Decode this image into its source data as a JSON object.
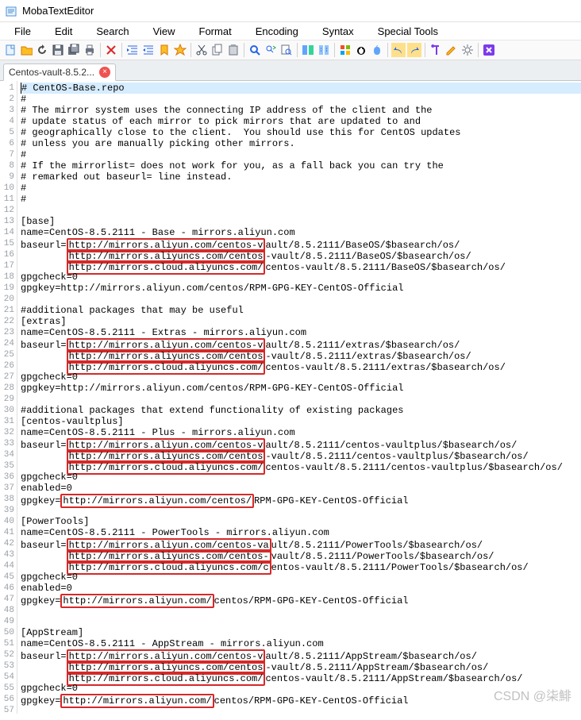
{
  "title": "MobaTextEditor",
  "menus": [
    "File",
    "Edit",
    "Search",
    "View",
    "Format",
    "Encoding",
    "Syntax",
    "Special Tools"
  ],
  "tab": {
    "label": "Centos-vault-8.5.2...",
    "close": "×"
  },
  "lines": [
    {
      "n": 1,
      "frag": [
        {
          "t": "# CentOS-Base.repo"
        }
      ],
      "current": true
    },
    {
      "n": 2,
      "frag": [
        {
          "t": "#"
        }
      ]
    },
    {
      "n": 3,
      "frag": [
        {
          "t": "# The mirror system uses the connecting IP address of the client and the"
        }
      ]
    },
    {
      "n": 4,
      "frag": [
        {
          "t": "# update status of each mirror to pick mirrors that are updated to and"
        }
      ]
    },
    {
      "n": 5,
      "frag": [
        {
          "t": "# geographically close to the client.  You should use this for CentOS updates"
        }
      ]
    },
    {
      "n": 6,
      "frag": [
        {
          "t": "# unless you are manually picking other mirrors."
        }
      ]
    },
    {
      "n": 7,
      "frag": [
        {
          "t": "#"
        }
      ]
    },
    {
      "n": 8,
      "frag": [
        {
          "t": "# If the mirrorlist= does not work for you, as a fall back you can try the"
        }
      ]
    },
    {
      "n": 9,
      "frag": [
        {
          "t": "# remarked out baseurl= line instead."
        }
      ]
    },
    {
      "n": 10,
      "frag": [
        {
          "t": "#"
        }
      ]
    },
    {
      "n": 11,
      "frag": [
        {
          "t": "#"
        }
      ]
    },
    {
      "n": 12,
      "frag": [
        {
          "t": ""
        }
      ]
    },
    {
      "n": 13,
      "frag": [
        {
          "t": "[base]"
        }
      ]
    },
    {
      "n": 14,
      "frag": [
        {
          "t": "name=CentOS-8.5.2111 - Base - mirrors.aliyun.com"
        }
      ]
    },
    {
      "n": 15,
      "frag": [
        {
          "t": "baseurl="
        },
        {
          "t": "http://mirrors.aliyun.com/centos-v",
          "hl": 1
        },
        {
          "t": "ault/8.5.2111/BaseOS/$basearch/os/"
        }
      ]
    },
    {
      "n": 16,
      "frag": [
        {
          "t": "        "
        },
        {
          "t": "http://mirrors.aliyuncs.com/centos",
          "hl": 1
        },
        {
          "t": "-vault/8.5.2111/BaseOS/$basearch/os/"
        }
      ]
    },
    {
      "n": 17,
      "frag": [
        {
          "t": "        "
        },
        {
          "t": "http://mirrors.cloud.aliyuncs.com/",
          "hl": 1
        },
        {
          "t": "centos-vault/8.5.2111/BaseOS/$basearch/os/"
        }
      ]
    },
    {
      "n": 18,
      "frag": [
        {
          "t": "gpgcheck=0"
        }
      ]
    },
    {
      "n": 19,
      "frag": [
        {
          "t": "gpgkey=http://mirrors.aliyun.com/centos/RPM-GPG-KEY-CentOS-Official"
        }
      ]
    },
    {
      "n": 20,
      "frag": [
        {
          "t": ""
        }
      ]
    },
    {
      "n": 21,
      "frag": [
        {
          "t": "#additional packages that may be useful"
        }
      ]
    },
    {
      "n": 22,
      "frag": [
        {
          "t": "[extras]"
        }
      ]
    },
    {
      "n": 23,
      "frag": [
        {
          "t": "name=CentOS-8.5.2111 - Extras - mirrors.aliyun.com"
        }
      ]
    },
    {
      "n": 24,
      "frag": [
        {
          "t": "baseurl="
        },
        {
          "t": "http://mirrors.aliyun.com/centos-v",
          "hl": 1
        },
        {
          "t": "ault/8.5.2111/extras/$basearch/os/"
        }
      ]
    },
    {
      "n": 25,
      "frag": [
        {
          "t": "        "
        },
        {
          "t": "http://mirrors.aliyuncs.com/centos",
          "hl": 1
        },
        {
          "t": "-vault/8.5.2111/extras/$basearch/os/"
        }
      ]
    },
    {
      "n": 26,
      "frag": [
        {
          "t": "        "
        },
        {
          "t": "http://mirrors.cloud.aliyuncs.com/",
          "hl": 1
        },
        {
          "t": "centos-vault/8.5.2111/extras/$basearch/os/"
        }
      ]
    },
    {
      "n": 27,
      "frag": [
        {
          "t": "gpgcheck=0"
        }
      ]
    },
    {
      "n": 28,
      "frag": [
        {
          "t": "gpgkey=http://mirrors.aliyun.com/centos/RPM-GPG-KEY-CentOS-Official"
        }
      ]
    },
    {
      "n": 29,
      "frag": [
        {
          "t": ""
        }
      ]
    },
    {
      "n": 30,
      "frag": [
        {
          "t": "#additional packages that extend functionality of existing packages"
        }
      ]
    },
    {
      "n": 31,
      "frag": [
        {
          "t": "[centos-vaultplus]"
        }
      ]
    },
    {
      "n": 32,
      "frag": [
        {
          "t": "name=CentOS-8.5.2111 - Plus - mirrors.aliyun.com"
        }
      ]
    },
    {
      "n": 33,
      "frag": [
        {
          "t": "baseurl="
        },
        {
          "t": "http://mirrors.aliyun.com/centos-v",
          "hl": 1
        },
        {
          "t": "ault/8.5.2111/centos-vaultplus/$basearch/os/"
        }
      ]
    },
    {
      "n": 34,
      "frag": [
        {
          "t": "        "
        },
        {
          "t": "http://mirrors.aliyuncs.com/centos",
          "hl": 1
        },
        {
          "t": "-vault/8.5.2111/centos-vaultplus/$basearch/os/"
        }
      ]
    },
    {
      "n": 35,
      "frag": [
        {
          "t": "        "
        },
        {
          "t": "http://mirrors.cloud.aliyuncs.com/",
          "hl": 1
        },
        {
          "t": "centos-vault/8.5.2111/centos-vaultplus/$basearch/os/"
        }
      ]
    },
    {
      "n": 36,
      "frag": [
        {
          "t": "gpgcheck=0"
        }
      ]
    },
    {
      "n": 37,
      "frag": [
        {
          "t": "enabled=0"
        }
      ]
    },
    {
      "n": 38,
      "frag": [
        {
          "t": "gpgkey="
        },
        {
          "t": "http://mirrors.aliyun.com/centos/",
          "hl": 1
        },
        {
          "t": "RPM-GPG-KEY-CentOS-Official"
        }
      ]
    },
    {
      "n": 39,
      "frag": [
        {
          "t": ""
        }
      ]
    },
    {
      "n": 40,
      "frag": [
        {
          "t": "[PowerTools]"
        }
      ]
    },
    {
      "n": 41,
      "frag": [
        {
          "t": "name=CentOS-8.5.2111 - PowerTools - mirrors.aliyun.com"
        }
      ]
    },
    {
      "n": 42,
      "frag": [
        {
          "t": "baseurl="
        },
        {
          "t": "http://mirrors.aliyun.com/centos-va",
          "hl": 1
        },
        {
          "t": "ult/8.5.2111/PowerTools/$basearch/os/"
        }
      ]
    },
    {
      "n": 43,
      "frag": [
        {
          "t": "        "
        },
        {
          "t": "http://mirrors.aliyuncs.com/centos-",
          "hl": 1
        },
        {
          "t": "vault/8.5.2111/PowerTools/$basearch/os/"
        }
      ]
    },
    {
      "n": 44,
      "frag": [
        {
          "t": "        "
        },
        {
          "t": "http://mirrors.cloud.aliyuncs.com/c",
          "hl": 1
        },
        {
          "t": "entos-vault/8.5.2111/PowerTools/$basearch/os/"
        }
      ]
    },
    {
      "n": 45,
      "frag": [
        {
          "t": "gpgcheck=0"
        }
      ]
    },
    {
      "n": 46,
      "frag": [
        {
          "t": "enabled=0"
        }
      ]
    },
    {
      "n": 47,
      "frag": [
        {
          "t": "gpgkey="
        },
        {
          "t": "http://mirrors.aliyun.com/",
          "hl": 1
        },
        {
          "t": "centos/RPM-GPG-KEY-CentOS-Official"
        }
      ]
    },
    {
      "n": 48,
      "frag": [
        {
          "t": ""
        }
      ]
    },
    {
      "n": 49,
      "frag": [
        {
          "t": ""
        }
      ]
    },
    {
      "n": 50,
      "frag": [
        {
          "t": "[AppStream]"
        }
      ]
    },
    {
      "n": 51,
      "frag": [
        {
          "t": "name=CentOS-8.5.2111 - AppStream - mirrors.aliyun.com"
        }
      ]
    },
    {
      "n": 52,
      "frag": [
        {
          "t": "baseurl="
        },
        {
          "t": "http://mirrors.aliyun.com/centos-v",
          "hl": 1
        },
        {
          "t": "ault/8.5.2111/AppStream/$basearch/os/"
        }
      ]
    },
    {
      "n": 53,
      "frag": [
        {
          "t": "        "
        },
        {
          "t": "http://mirrors.aliyuncs.com/centos",
          "hl": 1
        },
        {
          "t": "-vault/8.5.2111/AppStream/$basearch/os/"
        }
      ]
    },
    {
      "n": 54,
      "frag": [
        {
          "t": "        "
        },
        {
          "t": "http://mirrors.cloud.aliyuncs.com/",
          "hl": 1
        },
        {
          "t": "centos-vault/8.5.2111/AppStream/$basearch/os/"
        }
      ]
    },
    {
      "n": 55,
      "frag": [
        {
          "t": "gpgcheck=0"
        }
      ]
    },
    {
      "n": 56,
      "frag": [
        {
          "t": "gpgkey="
        },
        {
          "t": "http://mirrors.aliyun.com/",
          "hl": 1
        },
        {
          "t": "centos/RPM-GPG-KEY-CentOS-Official"
        }
      ]
    },
    {
      "n": 57,
      "frag": [
        {
          "t": ""
        }
      ]
    }
  ],
  "watermark": "CSDN @柒鯡",
  "toolbar_icons": [
    {
      "name": "new-file-icon",
      "svg": "<rect x='3' y='2' width='10' height='12' fill='#eaf3fc' stroke='#4a90d9'/><path d='M9 2v4h4' fill='none' stroke='#4a90d9'/>"
    },
    {
      "name": "open-folder-icon",
      "svg": "<path d='M2 4h5l2 2h7v8H2z' fill='#fbbf24' stroke='#d97706'/>"
    },
    {
      "name": "refresh-icon",
      "svg": "<path d='M8 3a5 5 0 1 0 5 5h-2a3 3 0 1 1-3-3V3z' fill='#4a4a4a'/><path d='M8 1l3 3-3 3z' fill='#4a4a4a'/>"
    },
    {
      "name": "save-icon",
      "svg": "<rect x='2' y='2' width='12' height='12' fill='#6b7280' stroke='#374151'/><rect x='5' y='2' width='6' height='4' fill='#fff'/><rect x='4' y='9' width='8' height='5' fill='#e5e7eb'/>"
    },
    {
      "name": "save-all-icon",
      "svg": "<rect x='1' y='4' width='10' height='10' fill='#6b7280'/><rect x='4' y='1' width='10' height='10' fill='#9ca3af' stroke='#374151'/><rect x='6' y='1' width='5' height='3' fill='#fff'/>"
    },
    {
      "name": "print-icon",
      "svg": "<rect x='3' y='6' width='10' height='6' fill='#6b7280'/><rect x='5' y='2' width='6' height='4' fill='#fff' stroke='#6b7280'/><rect x='5' y='10' width='6' height='4' fill='#fff' stroke='#6b7280'/>"
    },
    {
      "sep": true
    },
    {
      "name": "close-icon",
      "svg": "<path d='M3 3l10 10M13 3L3 13' stroke='#dc2626' stroke-width='2'/>"
    },
    {
      "sep": true
    },
    {
      "name": "indent-left-icon",
      "svg": "<path d='M2 3h12M2 13h12M6 6h8M6 10h8' stroke='#2563eb'/><path d='M4 8L1 6v4z' fill='#2563eb'/>"
    },
    {
      "name": "indent-right-icon",
      "svg": "<path d='M2 3h12M2 13h12M6 6h8M6 10h8' stroke='#2563eb'/><path d='M1 8l3-2v4z' fill='#2563eb'/>"
    },
    {
      "name": "bookmark-icon",
      "svg": "<path d='M4 2h8v12l-4-3-4 3z' fill='#fbbf24' stroke='#d97706'/>"
    },
    {
      "name": "star-icon",
      "svg": "<path d='M8 1l2 5h5l-4 3 2 5-5-3-5 3 2-5-4-3h5z' fill='#fbbf24' stroke='#d97706'/>"
    },
    {
      "sep": true
    },
    {
      "name": "cut-icon",
      "svg": "<circle cx='4' cy='12' r='2' fill='none' stroke='#374151'/><circle cx='12' cy='12' r='2' fill='none' stroke='#374151'/><path d='M5 11L12 2M11 11L4 2' stroke='#374151'/>"
    },
    {
      "name": "copy-icon",
      "svg": "<rect x='2' y='4' width='8' height='10' fill='#fff' stroke='#6b7280'/><rect x='5' y='1' width='8' height='10' fill='#fff' stroke='#6b7280'/>"
    },
    {
      "name": "paste-icon",
      "svg": "<rect x='3' y='3' width='10' height='11' fill='#d1d5db' stroke='#6b7280'/><rect x='5' y='1' width='6' height='3' fill='#9ca3af'/>"
    },
    {
      "sep": true
    },
    {
      "name": "search-icon",
      "svg": "<circle cx='7' cy='7' r='4' fill='none' stroke='#2563eb' stroke-width='2'/><path d='M10 10l4 4' stroke='#2563eb' stroke-width='2'/>"
    },
    {
      "name": "replace-icon",
      "svg": "<circle cx='6' cy='6' r='3' fill='none' stroke='#2563eb'/><path d='M8 8l3 3' stroke='#2563eb'/><path d='M11 3l3 2-3 2' fill='none' stroke='#16a34a'/>"
    },
    {
      "name": "find-files-icon",
      "svg": "<rect x='2' y='2' width='9' height='11' fill='#fff' stroke='#6b7280'/><circle cx='10' cy='10' r='3' fill='none' stroke='#2563eb'/><path d='M12 12l2 2' stroke='#2563eb'/>"
    },
    {
      "sep": true
    },
    {
      "name": "compare-icon",
      "svg": "<rect x='1' y='2' width='6' height='12' fill='#60a5fa'/><rect x='9' y='2' width='6' height='12' fill='#34d399'/>"
    },
    {
      "name": "diff-icon",
      "svg": "<rect x='2' y='2' width='5' height='12' fill='#93c5fd'/><rect x='9' y='2' width='5' height='12' fill='#93c5fd'/><path d='M4 6h1M4 9h1M11 6h1M11 9h1' stroke='#1e40af'/>"
    },
    {
      "sep": true
    },
    {
      "name": "windows-icon",
      "svg": "<rect x='2' y='2' width='5' height='5' fill='#f25022'/><rect x='9' y='2' width='5' height='5' fill='#7fba00'/><rect x='2' y='9' width='5' height='5' fill='#00a4ef'/><rect x='9' y='9' width='5' height='5' fill='#ffb900'/>"
    },
    {
      "name": "linux-icon",
      "svg": "<ellipse cx='8' cy='9' rx='5' ry='5' fill='#000'/><ellipse cx='8' cy='9' rx='3' ry='4' fill='#fff'/><circle cx='6' cy='6' r='1' fill='#000'/><circle cx='10' cy='6' r='1' fill='#000'/>"
    },
    {
      "name": "apple-icon",
      "svg": "<path d='M8 4c2 0 4 1 4 5s-2 5-4 5-4-1-4-5 2-5 4-5z' fill='#60a5fa'/><path d='M9 2c0 1-1 2-2 2 0-1 1-2 2-2z' fill='#60a5fa'/>"
    },
    {
      "sep": true
    },
    {
      "name": "undo-icon",
      "svg": "<path d='M5 8H2l3-4v3c4 0 7 2 7 6-1-3-3-5-7-5z' fill='#2563eb'/>",
      "bg": "#ffe08a"
    },
    {
      "name": "redo-icon",
      "svg": "<path d='M11 8h3l-3-4v3c-4 0-7 2-7 6 1-3 3-5 7-5z' fill='#2563eb'/>",
      "bg": "#ffe08a"
    },
    {
      "sep": true
    },
    {
      "name": "paragraph-icon",
      "svg": "<path d='M6 2h6v2h-2v10h-2V4H6a2 2 0 1 1 0-2z' fill='#7c3aed'/>"
    },
    {
      "name": "edit-icon",
      "svg": "<path d='M2 12l8-8 2 2-8 8H2v-2z' fill='#fbbf24' stroke='#d97706'/>"
    },
    {
      "name": "settings-icon",
      "svg": "<circle cx='8' cy='8' r='3' fill='none' stroke='#6b7280'/><path d='M8 1v3M8 12v3M1 8h3M12 8h3M3 3l2 2M11 11l2 2M13 3l-2 2M5 11l-2 2' stroke='#6b7280'/>"
    },
    {
      "sep": true
    },
    {
      "name": "exit-icon",
      "svg": "<rect x='1' y='1' width='14' height='14' rx='2' fill='#7c3aed'/><path d='M5 5l6 6M11 5l-6 6' stroke='#fff' stroke-width='2'/>"
    }
  ]
}
